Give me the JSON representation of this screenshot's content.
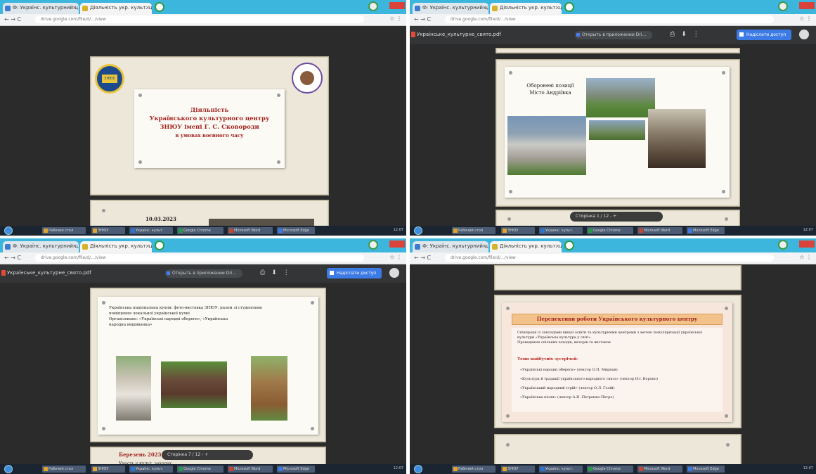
{
  "windows": [
    {
      "tabs": [
        "Ф: Українс. культурний ц...",
        "Діяльність укр. культ. центру"
      ],
      "url": "drive.google.com/file/d/.../view",
      "slide": {
        "title_lines": [
          "Діяльність",
          "Українського культурного центру",
          "ЗНЮУ імені Г. С. Сковороди",
          "в умовах воєнного часу"
        ],
        "next_date": "10.03.2023",
        "logo_left": "ЗНЮУ"
      }
    },
    {
      "tabs": [
        "Ф: Українс. культурний ц...",
        "Діяльність укр. культ. центру"
      ],
      "url": "drive.google.com/file/d/.../view",
      "doc_name": "Українське_культурне_свято.pdf",
      "zoom_label": "Открыть в приложении Dri...",
      "share_label": "Надіслати доступ",
      "slide": {
        "caption_lines": [
          "Оборонені позиції",
          "Місто Андріївка"
        ]
      },
      "page_chip": "Сторінка 1 / 12   -   +"
    },
    {
      "tabs": [
        "Ф: Українс. культурний ц...",
        "Діяльність укр. культ. центру"
      ],
      "url": "drive.google.com/file/d/.../view",
      "doc_name": "Українське_культурне_свято.pdf",
      "zoom_label": "Открыть в приложении Dri...",
      "share_label": "Надіслати доступ",
      "slide": {
        "text_lines": [
          "Українська національна кухня: фото-виставка ЗНЮУ, разом зі студентами",
          "поміщення локальної української кухні",
          "Організовано: «Українські народні обереги», «Українська",
          "народна вишиванка»"
        ]
      },
      "next_title": "Березень 2023",
      "next_sub": "Участь у культ. заходах",
      "page_chip": "Сторінка 7 / 12   -   +"
    },
    {
      "tabs": [
        "Ф: Українс. культурний ц...",
        "Діяльність укр. культ. центру"
      ],
      "url": "drive.google.com/file/d/.../view",
      "slide": {
        "heading": "Перспективи роботи Українського культурного центру",
        "bullets": [
          "Співпраця із закладами вищої освіти та культурними центрами з метою популяризації української культури «Українська культура у світі»",
          "Проведення спільних заходів, вечорів та виставок"
        ],
        "list_heading": "Теми майбутніх зустрічей:",
        "items": [
          "«Українські народні обереги» (лектор О.П. Мирная)",
          "«Культура й традиції українського народного свята» (лектор Н.І. Вороно)",
          "«Український народний стрій» (лектор О.Л. Голій)",
          "«Українська пісня» (лектор А.Н. Петренко-Петро)"
        ]
      }
    }
  ],
  "taskbar": {
    "buttons": [
      "Рабочий стол",
      "ЗНЮУ",
      "Українс. культ.",
      "Microsoft Word",
      "Google Chrome",
      "Microsoft Edge"
    ],
    "time": "12:07"
  }
}
